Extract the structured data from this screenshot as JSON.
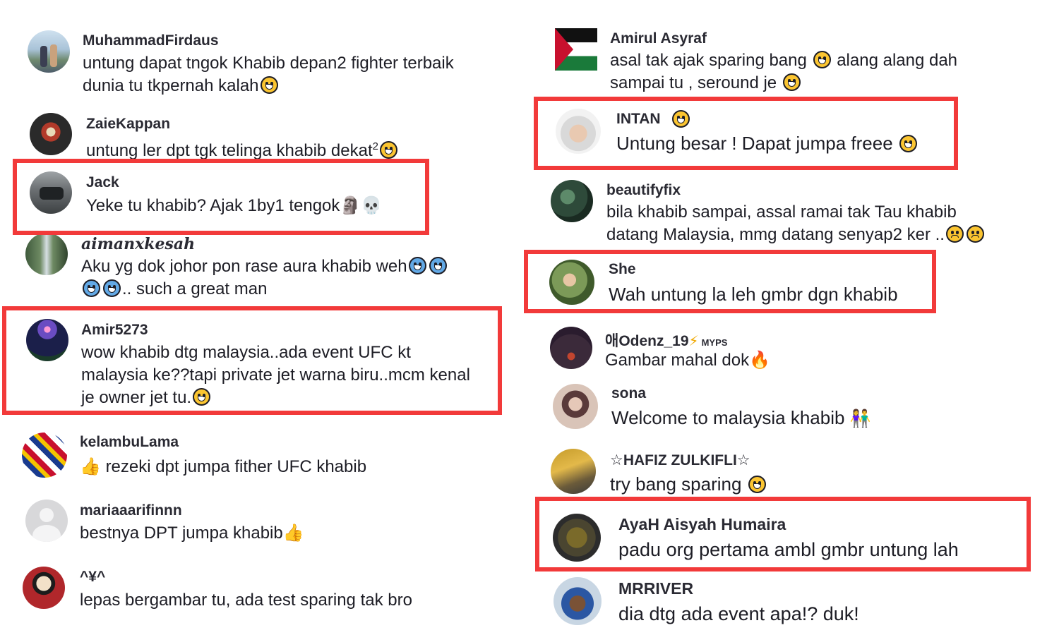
{
  "comments_left": [
    {
      "username": "MuhammadFirdaus",
      "text_line1": "untung dapat tngok Khabib depan2 fighter terbaik",
      "text_line2": "dunia tu tkpernah kalah"
    },
    {
      "username": "ZaieKappan",
      "text_line1": "untung ler dpt tgk telinga khabib dekat",
      "sup": "2"
    },
    {
      "username": "Jack",
      "text_line1": "Yeke tu khabib? Ajak 1by1 tengok"
    },
    {
      "username": "aimanxkesah",
      "text_line1": "Aku yg dok johor pon rase aura khabib weh",
      "text_line2": ".. such a great man"
    },
    {
      "username": "Amir5273",
      "text_line1": "wow khabib dtg malaysia..ada event UFC kt",
      "text_line2": "malaysia ke??tapi private jet warna biru..mcm kenal",
      "text_line3": "je owner jet tu."
    },
    {
      "username": "kelambuLama",
      "text_line1": "rezeki dpt jumpa fither UFC khabib"
    },
    {
      "username": "mariaaarifinnn",
      "text_line1": "bestnya DPT jumpa khabib"
    },
    {
      "username": "^¥^",
      "text_line1": "lepas bergambar tu, ada test sparing tak bro"
    }
  ],
  "comments_right": [
    {
      "username": "Amirul Asyraf",
      "text_line1": "asal tak ajak sparing bang",
      "text_mid": "alang alang dah",
      "text_line2": "sampai tu , seround je"
    },
    {
      "username": "INTAN",
      "text_line1": "Untung besar ! Dapat jumpa freee"
    },
    {
      "username": "beautifyfix",
      "text_line1": "bila khabib sampai, assal ramai tak Tau khabib",
      "text_line2": "datang Malaysia, mmg datang senyap2 ker .."
    },
    {
      "username": "She",
      "text_line1": "Wah untung la leh gmbr dgn khabib"
    },
    {
      "username": "애Odenz_19",
      "badge": "MYPS",
      "text_line1": "Gambar mahal dok"
    },
    {
      "username": "sona",
      "text_line1": "Welcome to malaysia khabib"
    },
    {
      "username": "☆HAFIZ ZULKIFLI☆",
      "text_line1": "try bang sparing"
    },
    {
      "username": "AyaH Aisyah Humaira",
      "text_line1": "padu org pertama ambl gmbr untung lah"
    },
    {
      "username": "MRRIVER",
      "text_line1": "dia dtg ada event apa!? duk!"
    }
  ],
  "icons": {
    "thumbs_up": "👍",
    "skull": "💀",
    "moai": "🗿",
    "fire": "🔥",
    "lightning": "⚡",
    "couple": "👫"
  },
  "highlight_color": "#f23a3a"
}
